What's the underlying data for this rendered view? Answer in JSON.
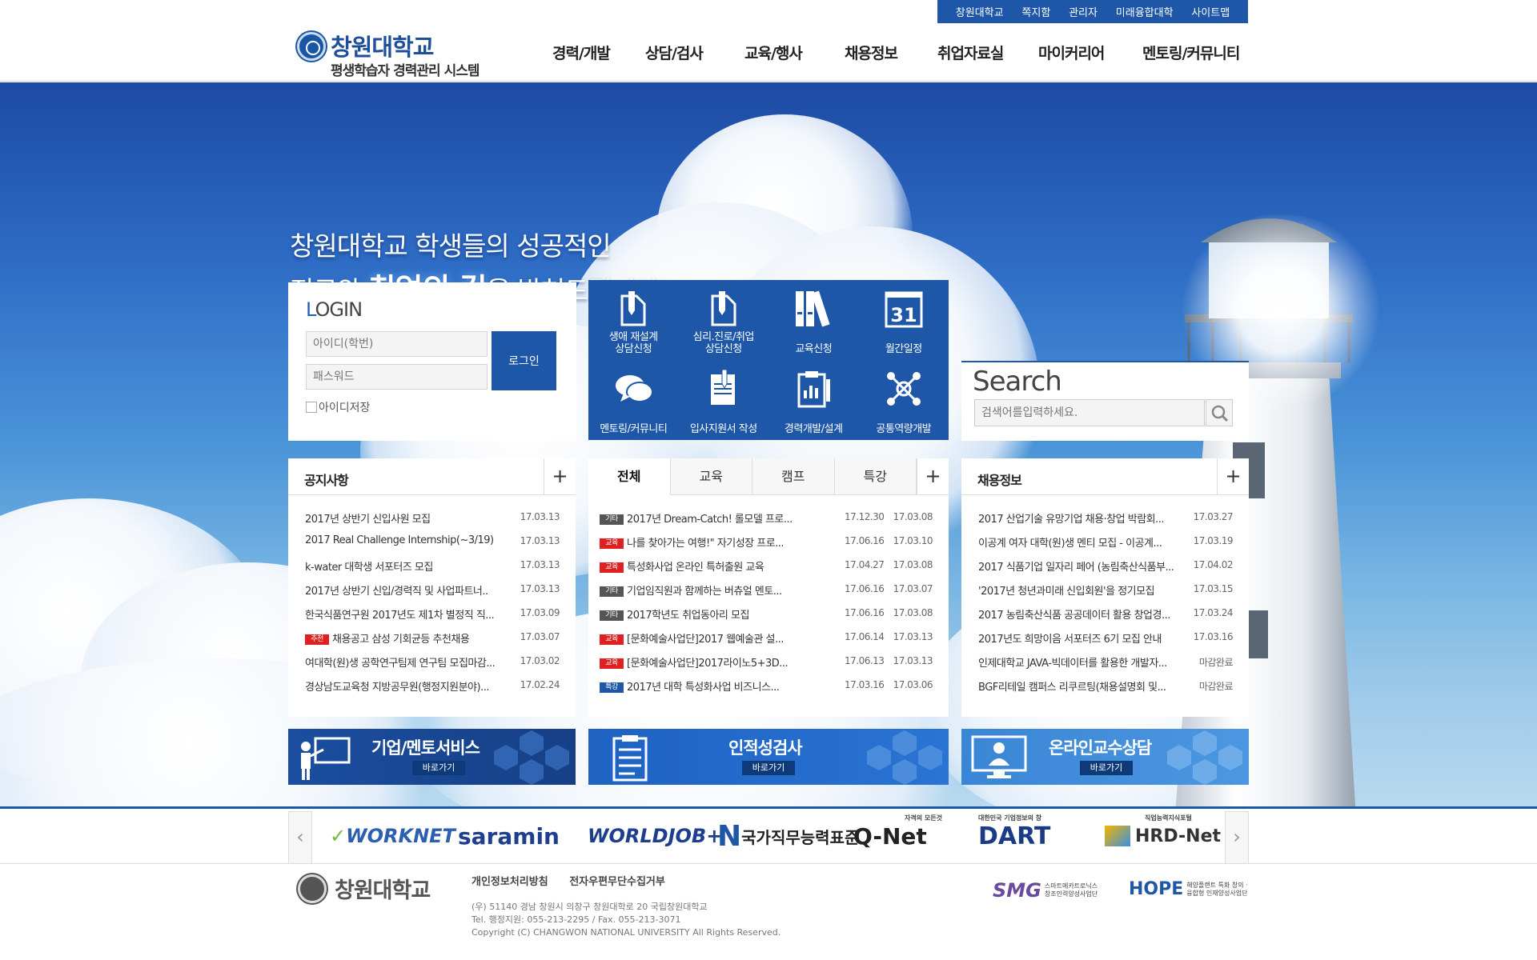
{
  "util_links": [
    "창원대학교",
    "쪽지함",
    "관리자",
    "미래융합대학",
    "사이트맵"
  ],
  "logo": {
    "name": "창원대학교",
    "subtitle": "평생학습자 경력관리 시스템"
  },
  "gnb": [
    "경력/개발",
    "상담/검사",
    "교육/행사",
    "채용정보",
    "취업자료실",
    "마이커리어",
    "멘토링/커뮤니티"
  ],
  "slogan": {
    "line1": "창원대학교 학생들의 성공적인",
    "line2_pre": "진로와 ",
    "line2_em": "취업의 길",
    "line2_post": "을 밝혀드립니다"
  },
  "login": {
    "title_first": "L",
    "title_rest": "OGIN",
    "id_placeholder": "아이디(학번)",
    "pw_placeholder": "패스워드",
    "button": "로그인",
    "save_id": "아이디저장"
  },
  "quick_menu": [
    {
      "label": "생애 재설계\n상담신청",
      "icon": "pen-document-icon"
    },
    {
      "label": "심리.진로/취업\n상담신청",
      "icon": "pen-document-icon"
    },
    {
      "label": "교육신청",
      "icon": "binders-icon"
    },
    {
      "label": "월간일정",
      "icon": "calendar-icon",
      "day": "31"
    },
    {
      "label": "멘토링/커뮤니티",
      "icon": "speech-bubbles-icon"
    },
    {
      "label": "입사지원서 작성",
      "icon": "resume-icon"
    },
    {
      "label": "경력개발/설계",
      "icon": "clipboard-chart-icon"
    },
    {
      "label": "공통역량개발",
      "icon": "network-icon"
    }
  ],
  "search": {
    "title": "Search",
    "placeholder": "검색어를입력하세요."
  },
  "notice": {
    "title": "공지사항",
    "more": "+",
    "items": [
      {
        "title": "2017년 상반기 신입사원 모집",
        "date": "17.03.13"
      },
      {
        "title": "2017 Real Challenge Internship(~3/19)",
        "date": "17.03.13"
      },
      {
        "title": "k-water 대학생 서포터즈 모집",
        "date": "17.03.13"
      },
      {
        "title": "2017년 상반기 신입/경력직 및 사업파트너..",
        "date": "17.03.13"
      },
      {
        "title": "한국식품연구원 2017년도 제1차 별정직 직...",
        "date": "17.03.09"
      },
      {
        "badge": "추천",
        "title": "채용공고 삼성 기회균등 추천채용",
        "date": "17.03.07"
      },
      {
        "title": "여대학(원)생 공학연구팀제 연구팀 모집마감...",
        "date": "17.03.02"
      },
      {
        "title": "경상남도교육청 지방공무원(행정지원분야)...",
        "date": "17.02.24"
      }
    ]
  },
  "program": {
    "tabs": [
      "전체",
      "교육",
      "캠프",
      "특강"
    ],
    "more": "+",
    "items": [
      {
        "badge": "기타",
        "title": "2017년 Dream-Catch! 롤모델 프로...",
        "date1": "17.12.30",
        "date2": "17.03.08"
      },
      {
        "badge": "교육",
        "title": "나를 찾아가는 여행!\" 자기성장 프로...",
        "date1": "17.06.16",
        "date2": "17.03.10"
      },
      {
        "badge": "교육",
        "title": "특성화사업 온라인 특허출원 교육",
        "date1": "17.04.27",
        "date2": "17.03.08"
      },
      {
        "badge": "기타",
        "title": "기업임직원과 함께하는 버츄얼 멘토...",
        "date1": "17.06.16",
        "date2": "17.03.07"
      },
      {
        "badge": "기타",
        "title": "2017학년도 취업동아리 모집",
        "date1": "17.06.16",
        "date2": "17.03.08"
      },
      {
        "badge": "교육",
        "title": "[문화예술사업단]2017 웹예술관 설...",
        "date1": "17.06.14",
        "date2": "17.03.13"
      },
      {
        "badge": "교육",
        "title": "[문화예술사업단]2017라이노5+3D...",
        "date1": "17.06.13",
        "date2": "17.03.13"
      },
      {
        "badge": "특강",
        "title": "2017년 대학 특성화사업 비즈니스...",
        "date1": "17.03.16",
        "date2": "17.03.06"
      }
    ]
  },
  "jobs": {
    "title": "채용정보",
    "more": "+",
    "items": [
      {
        "title": "2017 산업기술 유망기업 채용·창업 박람회...",
        "date": "17.03.27"
      },
      {
        "title": "이공계 여자 대학(원)생 멘티 모집 - 이공계...",
        "date": "17.03.19"
      },
      {
        "title": "2017 식품기업 일자리 페어 (농림축산식품부...",
        "date": "17.04.02"
      },
      {
        "title": "'2017년 청년과미래 신입회원'을 정기모집",
        "date": "17.03.15"
      },
      {
        "title": "2017 농림축산식품 공공데이터 활용 창업경...",
        "date": "17.03.24"
      },
      {
        "title": "2017년도 희망이음 서포터즈 6기 모집 안내",
        "date": "17.03.16"
      },
      {
        "title": "인제대학교 JAVA-빅데이터를 활용한 개발자...",
        "date": "마감완료"
      },
      {
        "title": "BGF리테일 캠퍼스 리쿠르팅(채용설명회 및...",
        "date": "마감완료"
      }
    ]
  },
  "banners": [
    {
      "title": "기업/멘토서비스",
      "go": "바로가기",
      "icon": "presenter-icon"
    },
    {
      "title": "인적성검사",
      "go": "바로가기",
      "icon": "checklist-icon"
    },
    {
      "title": "온라인교수상담",
      "go": "바로가기",
      "icon": "monitor-person-icon"
    }
  ],
  "partners": [
    {
      "name": "WORKNET"
    },
    {
      "name": "saramin"
    },
    {
      "name": "WORLDJOB+"
    },
    {
      "name": "국가직무능력표준",
      "prefix": "N"
    },
    {
      "name": "Q-Net",
      "small": "자격의 모든것"
    },
    {
      "name": "DART",
      "small": "대한민국 기업정보의 창"
    },
    {
      "name": "HRD-Net",
      "small": "직업능력지식포털"
    }
  ],
  "footer": {
    "logo": "창원대학교",
    "links": [
      "개인정보처리방침",
      "전자우편무단수집거부"
    ],
    "address": "(우) 51140 경남 창원시 의창구 창원대학로 20 국립창원대학교",
    "tel": "Tel. 행정지원: 055-213-2295 / Fax. 055-213-3071",
    "copyright": "Copyright (C) CHANGWON NATIONAL UNIVERSITY All Rights Reserved.",
    "smg": "SMG",
    "smg_sub": "스마트메카트로닉스\n창조인력양성사업단",
    "hope": "HOPE",
    "hope_sub": "해양플랜트 특화 창의 ·\n융합형 인재양성사업단"
  },
  "colors": {
    "brand": "#1e56a8",
    "badge_etc": "#555555",
    "badge_edu": "#e02020",
    "badge_special": "#1e56a8"
  }
}
